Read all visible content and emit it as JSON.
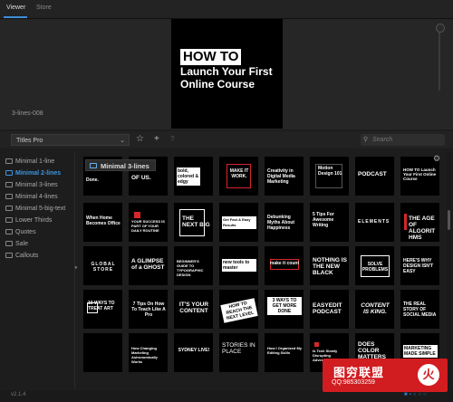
{
  "tabs": [
    {
      "label": "Viewer"
    },
    {
      "label": "Store"
    }
  ],
  "viewer": {
    "preview_title_boxed": "HOW TO",
    "preview_title_lines": [
      "Launch Your First",
      "Online Course"
    ],
    "preset_name": "3-lines-008"
  },
  "toolbar": {
    "pack_select": "Titles Pro",
    "favorite_icon": "star-outline-icon",
    "add_icon": "plus-icon",
    "help_icon": "question-icon",
    "search_placeholder": "Search"
  },
  "sidebar": {
    "categories": [
      {
        "label": "Minimal 1-line",
        "selected": false
      },
      {
        "label": "Minimal 2-lines",
        "selected": true
      },
      {
        "label": "Minimal 3-lines",
        "selected": false
      },
      {
        "label": "Minimal 4-lines",
        "selected": false
      },
      {
        "label": "Minimal 5-big-text",
        "selected": false
      },
      {
        "label": "Lower Thirds",
        "selected": false
      },
      {
        "label": "Quotes",
        "selected": false
      },
      {
        "label": "Sale",
        "selected": false
      },
      {
        "label": "Callouts",
        "selected": false
      }
    ]
  },
  "tooltip": {
    "label": "Minimal 3-lines"
  },
  "grid": {
    "rows": [
      [
        "Done.",
        "OF US.",
        "bold, colored & edgy",
        "MAKE IT WORK.",
        "Creativity in Digital Media Marketing",
        "Motion Design 101",
        "PODCAST",
        "HOW TO Launch Your First Online Course"
      ],
      [
        "When Home Becomes Office",
        "YOUR SUCCESS IS PART OF YOUR DAILY ROUTINE",
        "THE NEXT BIG",
        "Get Fast & Easy Results",
        "Debunking Myths About Happiness",
        "5 Tips For Awesome Writing",
        "ELEMENTS",
        "THE AGE OF ALGORITHMS"
      ],
      [
        "GLOBAL STORE",
        "A GLIMPSE of a GHOST",
        "BEGINNER'S GUIDE TO TYPOGRAPHIC DESIGN",
        "new tools to master",
        "make it count",
        "NOTHING IS THE NEW BLACK",
        "SOLVE PROBLEMS",
        "HERE'S WHY DESIGN ISN'T EASY"
      ],
      [
        "10 WAYS TO TREAT ART",
        "7 Tips On How To Teach Like A Pro",
        "IT'S YOUR CONTENT",
        "HOW TO REACH THE NEXT LEVEL",
        "3 WAYS TO GET MORE DONE",
        "EASYEDIT PODCAST",
        "CONTENT IS KING.",
        "THE REAL STORY OF SOCIAL MEDIA"
      ],
      [
        "",
        "How Changing Marketing Astronomically Works",
        "SYDNEY LIVE!",
        "STORIES IN PLACE",
        "How I Organized My Editing Skills",
        "Is Tech Slowly Disrupting Advertising",
        "DOES COLOR MATTERS",
        "MARKETING MADE SIMPLE"
      ]
    ]
  },
  "status": {
    "version": "v2.1.4"
  },
  "watermark": {
    "title": "图穷联盟",
    "subtitle": "QQ:985303259",
    "logo_glyph": "火"
  },
  "colors": {
    "accent": "#3d95e0",
    "red": "#d5262b",
    "panel": "#1d1d1d"
  }
}
